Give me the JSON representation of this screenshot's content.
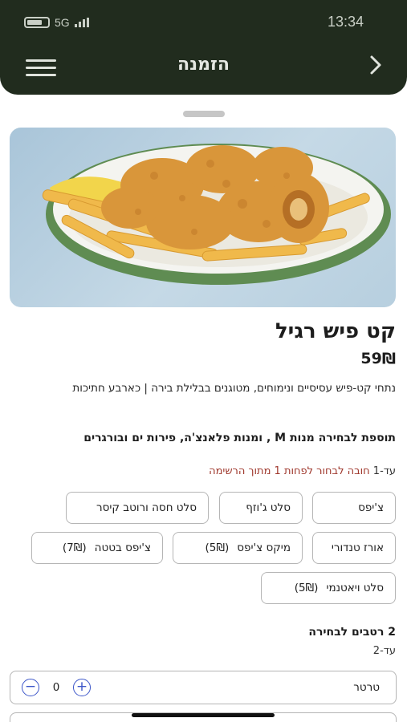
{
  "status": {
    "network": "5G",
    "time": "13:34"
  },
  "header": {
    "title": "הזמנה",
    "back_icon": "chevron-right-icon",
    "menu_icon": "hamburger-menu-icon"
  },
  "dish": {
    "name": "קט פיש רגיל",
    "price": "59₪",
    "description": "נתחי קט-פיש עסיסיים ונימוחים, מטוגנים בבלילת בירה | כארבע חתיכות"
  },
  "options": {
    "title": "תוספת לבחירה מנות M , ומנות פלאנצ'ה, פירות ים ובורגרים",
    "limit_label": "עד-1",
    "required_note": "חובה לבחור לפחות 1 מתוך הרשימה",
    "items": [
      {
        "label": "צ'יפס",
        "extra": ""
      },
      {
        "label": "סלט ג'וזף",
        "extra": ""
      },
      {
        "label": "סלט חסה ורוטב קיסר",
        "extra": ""
      },
      {
        "label": "אורז טנדורי",
        "extra": ""
      },
      {
        "label": "מיקס צ'יפס",
        "extra": "(5₪)"
      },
      {
        "label": "צ'יפס בטטה",
        "extra": "(7₪)"
      },
      {
        "label": "סלט ויאטנמי",
        "extra": "(5₪)"
      }
    ]
  },
  "sauces": {
    "title": "2 רטבים לבחירה",
    "limit_label": "עד-2",
    "items": [
      {
        "label": "טרטר",
        "count": "0"
      }
    ]
  },
  "colors": {
    "header_bg": "#212c1e",
    "stepper": "#3b55c8",
    "required": "#a0392e"
  }
}
